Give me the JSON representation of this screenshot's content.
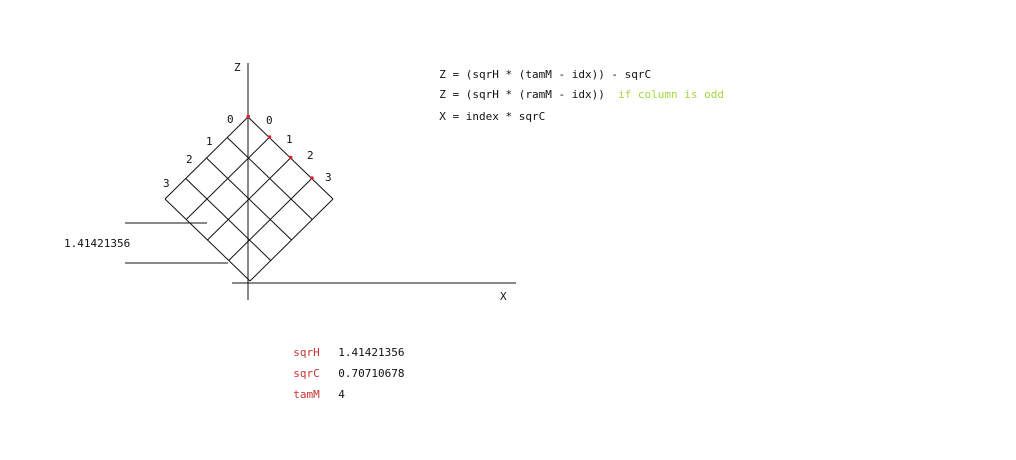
{
  "axes": {
    "z_label": "Z",
    "x_label": "X"
  },
  "grid": {
    "size": 4,
    "left_indices": [
      "0",
      "1",
      "2",
      "3"
    ],
    "right_indices": [
      "0",
      "1",
      "2",
      "3"
    ],
    "marked_cells": [
      [
        0,
        0
      ],
      [
        0,
        1
      ],
      [
        0,
        2
      ],
      [
        0,
        3
      ]
    ],
    "measurement": "1.41421356"
  },
  "formulas": [
    {
      "text": "Z = (sqrH * (tamM - idx)) - sqrC",
      "note": ""
    },
    {
      "text": "Z = (sqrH * (ramM - idx))  ",
      "note": "if column is odd"
    },
    {
      "text": "X = index * sqrC",
      "note": ""
    }
  ],
  "variables": [
    {
      "name": "sqrH",
      "value": "1.41421356"
    },
    {
      "name": "sqrC",
      "value": "0.70710678"
    },
    {
      "name": "tamM",
      "value": "4"
    }
  ],
  "colors": {
    "line": "#111111",
    "marker": "#e0202a",
    "variable": "#c83232",
    "note": "#a6d63f"
  }
}
